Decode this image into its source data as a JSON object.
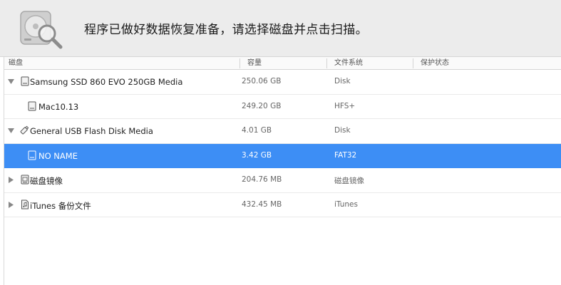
{
  "header": {
    "title": "程序已做好数据恢复准备，请选择磁盘并点击扫描。",
    "icon": "hard-disk-magnifier-icon"
  },
  "columns": [
    "磁盘",
    "容量",
    "文件系统",
    "保护状态"
  ],
  "rows": [
    {
      "name": "Samsung SSD 860 EVO 250GB Media",
      "capacity": "250.06 GB",
      "fs": "Disk",
      "protection": "",
      "disclosure": "expanded",
      "icon": "drive-icon",
      "level": 0
    },
    {
      "name": "Mac10.13",
      "capacity": "249.20 GB",
      "fs": "HFS+",
      "protection": "",
      "disclosure": "none",
      "icon": "volume-icon",
      "level": 1
    },
    {
      "name": "General USB Flash Disk Media",
      "capacity": "4.01 GB",
      "fs": "Disk",
      "protection": "",
      "disclosure": "expanded",
      "icon": "usb-drive-icon",
      "level": 0
    },
    {
      "name": "NO NAME",
      "capacity": "3.42 GB",
      "fs": "FAT32",
      "protection": "",
      "disclosure": "none",
      "icon": "volume-icon",
      "level": 1,
      "selected": true
    },
    {
      "name": "磁盘镜像",
      "capacity": "204.76 MB",
      "fs": "磁盘镜像",
      "protection": "",
      "disclosure": "collapsed",
      "icon": "disk-image-icon",
      "level": 0
    },
    {
      "name": "iTunes 备份文件",
      "capacity": "432.45 MB",
      "fs": "iTunes",
      "protection": "",
      "disclosure": "collapsed",
      "icon": "backup-file-icon",
      "level": 0
    }
  ],
  "colors": {
    "selection": "#3d8ef5",
    "header_bg": "#ececec"
  }
}
